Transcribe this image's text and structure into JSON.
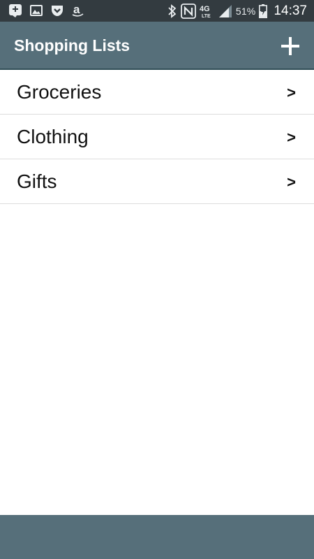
{
  "status_bar": {
    "notification_icons": [
      "messenger-icon",
      "gallery-icon",
      "pocket-icon",
      "amazon-icon"
    ],
    "system_icons": [
      "bluetooth-icon",
      "nfc-icon",
      "4g-lte-icon",
      "signal-icon"
    ],
    "battery_percent": "51%",
    "time": "14:37"
  },
  "app_bar": {
    "title": "Shopping Lists",
    "add_icon": "plus-icon"
  },
  "lists": [
    {
      "label": "Groceries",
      "chevron": ">"
    },
    {
      "label": "Clothing",
      "chevron": ">"
    },
    {
      "label": "Gifts",
      "chevron": ">"
    }
  ],
  "colors": {
    "status_bar_bg": "#333b40",
    "app_bar_bg": "#566f7a",
    "bottom_bar_bg": "#566f7a",
    "list_text": "#111111",
    "divider": "#dddddd"
  }
}
